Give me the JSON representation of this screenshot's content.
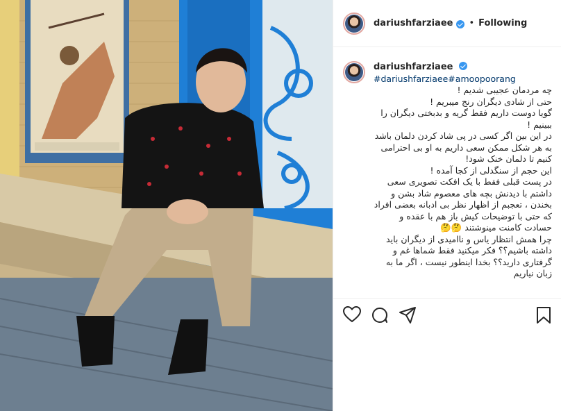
{
  "post": {
    "username": "dariushfarziaee",
    "follow_label": "Following",
    "separator": "•",
    "hashtags": "#dariushfarziaee#amoopoorang",
    "caption_lines": [
      "چه مردمان عجیبی شدیم !",
      "حتی از شادی دیگران رنج میبریم !",
      "گویا دوست داریم فقط گریه و بدبختی دیگران را ببینیم !",
      "در این بین اگر کسی در پی شاد کردن دلمان باشد به هر شکل ممکن سعی داریم به او بی احترامی کنیم تا دلمان خنک شود!",
      "این حجم از سنگدلی از کجا آمده !",
      "در پست قبلی فقط با یک افکت تصویری سعی داشتم با دیدنش بچه های معصوم شاد بشن و بخندن ، تعجبم از اظهار نظر بی ادبانه بعضی افراد که حتی با توضیحات کیش باز هم با عقده و حسادت کامنت مینوشتند 🤔🤔",
      "چرا همش انتظار یاس و ناامیدی از دیگران باید داشته باشیم؟؟ فکر میکنید فقط شماها غم و گرفتاری دارید؟؟ بخدا اینطور نیست ، اگر ما به زبان نیاریم"
    ]
  },
  "icons": {
    "like": "heart-icon",
    "comment": "comment-icon",
    "share": "share-icon",
    "save": "bookmark-icon"
  },
  "colors": {
    "verified": "#3897f0",
    "hashtag": "#00376b",
    "text": "#262626",
    "door_blue": "#1f7fd6"
  }
}
